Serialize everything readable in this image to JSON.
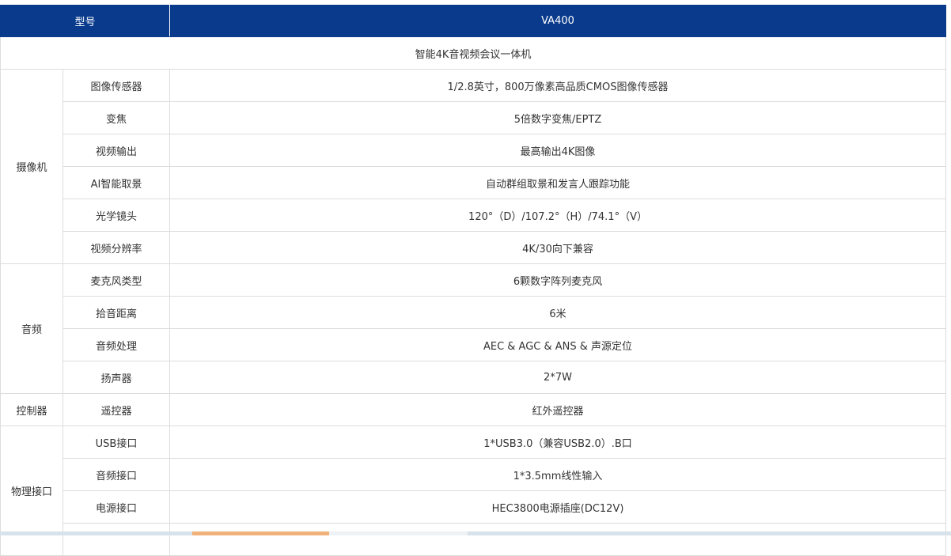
{
  "header": {
    "model_label": "型号",
    "model_value": "VA400"
  },
  "subtitle": "智能4K音视频会议一体机",
  "groups": [
    {
      "name": "摄像机",
      "rows": [
        {
          "label": "图像传感器",
          "value": "1/2.8英寸，800万像素高品质CMOS图像传感器"
        },
        {
          "label": "变焦",
          "value": "5倍数字变焦/EPTZ"
        },
        {
          "label": "视频输出",
          "value": "最高输出4K图像"
        },
        {
          "label": "AI智能取景",
          "value": "自动群组取景和发言人跟踪功能"
        },
        {
          "label": "光学镜头",
          "value": "120°（D）/107.2°（H）/74.1°（V）"
        },
        {
          "label": "视频分辨率",
          "value": "4K/30向下兼容"
        }
      ]
    },
    {
      "name": "音频",
      "rows": [
        {
          "label": "麦克风类型",
          "value": "6颗数字阵列麦克风"
        },
        {
          "label": "拾音距离",
          "value": "6米"
        },
        {
          "label": "音频处理",
          "value": "AEC & AGC & ANS & 声源定位"
        },
        {
          "label": "扬声器",
          "value": "2*7W"
        }
      ]
    },
    {
      "name": "控制器",
      "rows": [
        {
          "label": "遥控器",
          "value": "红外遥控器"
        }
      ]
    },
    {
      "name": "物理接口",
      "rows": [
        {
          "label": "USB接口",
          "value": "1*USB3.0（兼容USB2.0）.B口"
        },
        {
          "label": "音频接口",
          "value": "1*3.5mm线性输入"
        },
        {
          "label": "电源接口",
          "value": "HEC3800电源插座(DC12V)"
        },
        {
          "label": "",
          "value": ""
        }
      ]
    }
  ]
}
